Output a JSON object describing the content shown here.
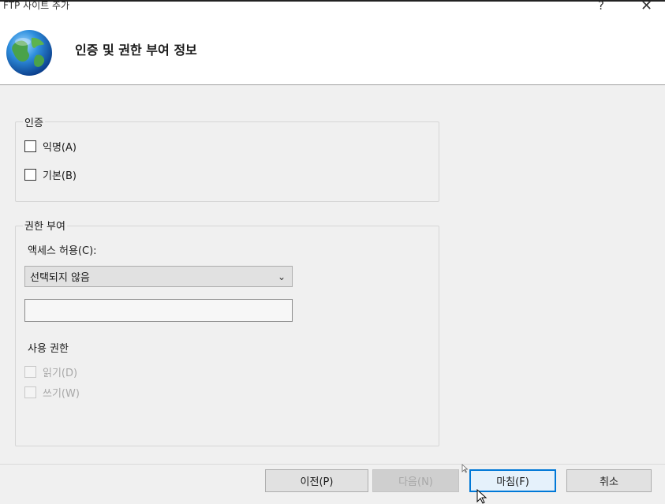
{
  "window": {
    "title": "FTP 사이트 추가",
    "help_label": "?",
    "close_label": "✕"
  },
  "header": {
    "title": "인증 및 권한 부여 정보",
    "icon": "globe-icon"
  },
  "authentication": {
    "legend": "인증",
    "options": [
      {
        "label": "익명(A)",
        "checked": false,
        "enabled": true
      },
      {
        "label": "기본(B)",
        "checked": false,
        "enabled": true
      }
    ]
  },
  "authorization": {
    "legend": "권한 부여",
    "access_label": "액세스 허용(C):",
    "access_selected": "선택되지 않음",
    "access_text_value": "",
    "permissions_label": "사용 권한",
    "permissions": [
      {
        "label": "읽기(D)",
        "checked": false,
        "enabled": false
      },
      {
        "label": "쓰기(W)",
        "checked": false,
        "enabled": false
      }
    ]
  },
  "buttons": {
    "prev": "이전(P)",
    "next": "다음(N)",
    "finish": "마침(F)",
    "cancel": "취소"
  },
  "colors": {
    "accent": "#0078d7",
    "dialog_bg": "#f0f0f0",
    "header_bg": "#ffffff"
  }
}
